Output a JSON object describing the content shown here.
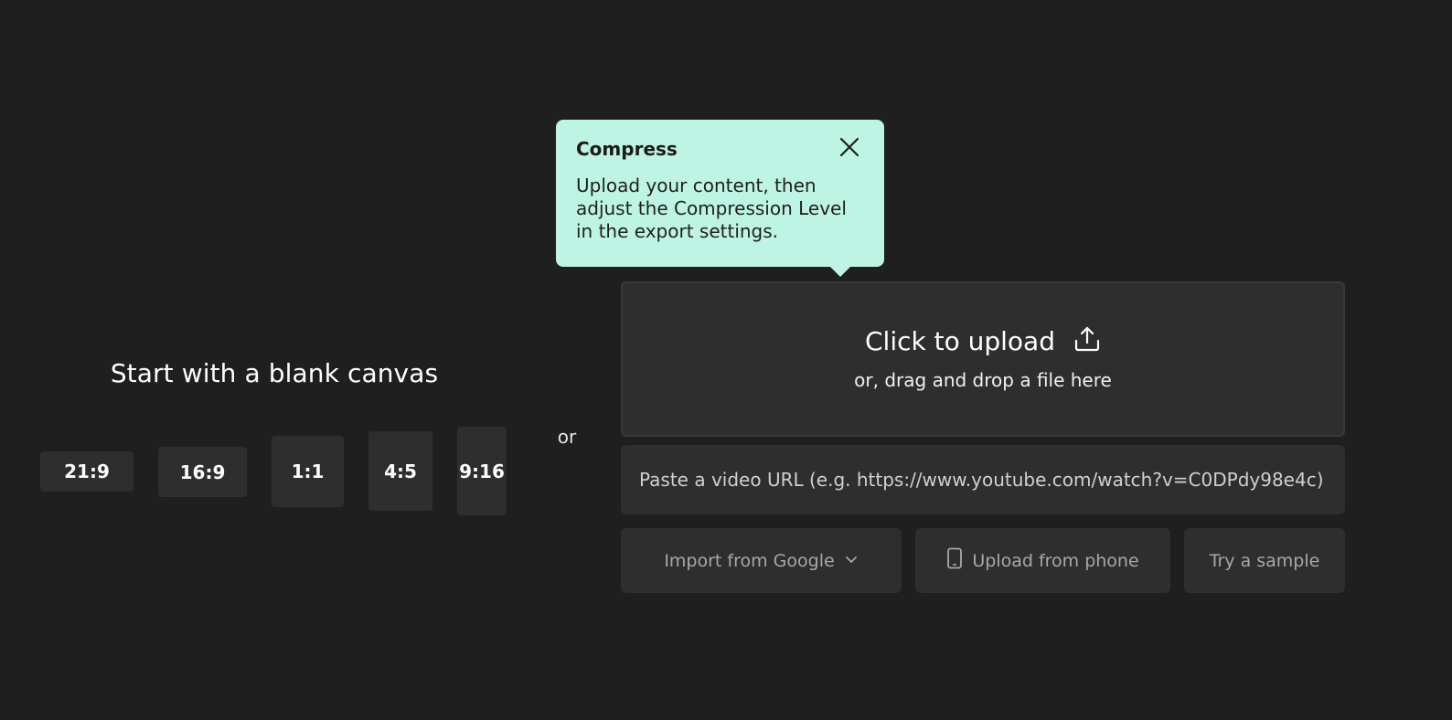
{
  "blank_canvas": {
    "title": "Start with a blank canvas",
    "ratios": [
      "21:9",
      "16:9",
      "1:1",
      "4:5",
      "9:16"
    ]
  },
  "separator": "or",
  "upload": {
    "title": "Click to upload",
    "subtitle": "or, drag and drop a file here",
    "icon": "upload-icon"
  },
  "url_input": {
    "placeholder": "Paste a video URL (e.g. https://www.youtube.com/watch?v=C0DPdy98e4c)",
    "value": ""
  },
  "actions": {
    "import_google": "Import from Google",
    "upload_phone": "Upload from phone",
    "try_sample": "Try a sample"
  },
  "tooltip": {
    "title": "Compress",
    "body": "Upload your content, then adjust the Compression Level in the export settings."
  },
  "colors": {
    "background": "#1f1f1f",
    "panel": "#2e2e2e",
    "tooltip": "#bdf4e3",
    "muted_text": "#a8a8a8"
  }
}
